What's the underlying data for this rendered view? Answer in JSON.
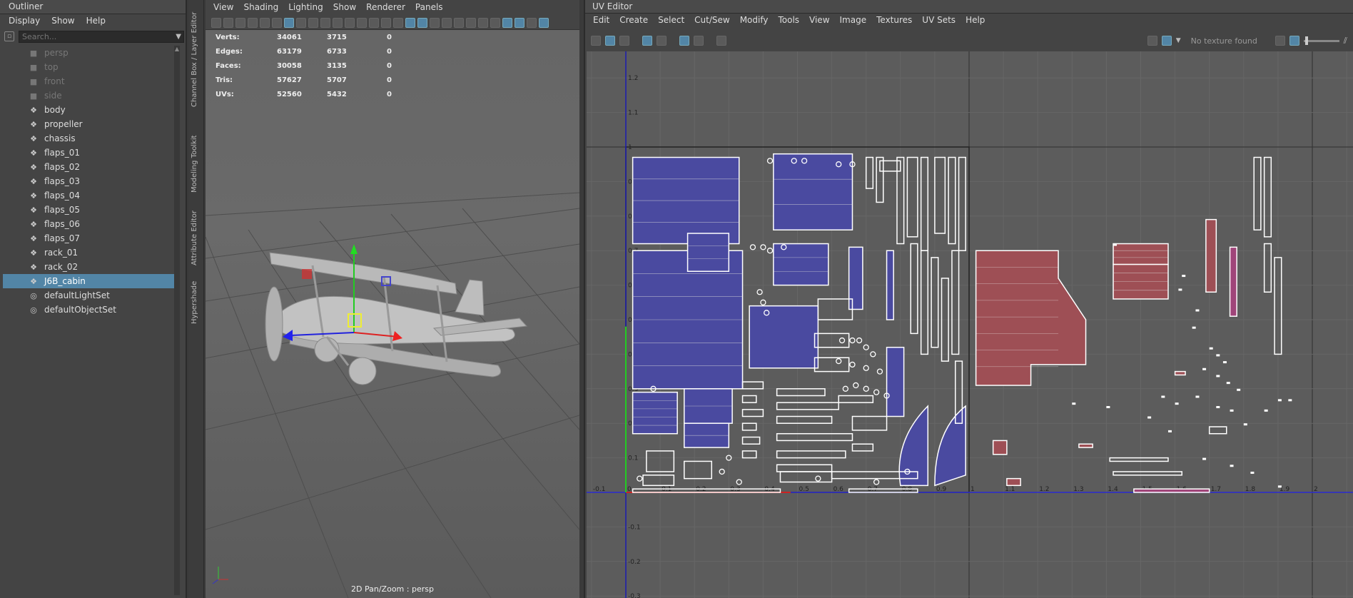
{
  "outliner": {
    "title": "Outliner",
    "menu": [
      "Display",
      "Show",
      "Help"
    ],
    "search_placeholder": "Search...",
    "items": [
      {
        "label": "persp",
        "kind": "camera"
      },
      {
        "label": "top",
        "kind": "camera"
      },
      {
        "label": "front",
        "kind": "camera"
      },
      {
        "label": "side",
        "kind": "camera"
      },
      {
        "label": "body",
        "kind": "mesh"
      },
      {
        "label": "propeller",
        "kind": "mesh"
      },
      {
        "label": "chassis",
        "kind": "mesh"
      },
      {
        "label": "flaps_01",
        "kind": "mesh"
      },
      {
        "label": "flaps_02",
        "kind": "mesh"
      },
      {
        "label": "flaps_03",
        "kind": "mesh"
      },
      {
        "label": "flaps_04",
        "kind": "mesh"
      },
      {
        "label": "flaps_05",
        "kind": "mesh"
      },
      {
        "label": "flaps_06",
        "kind": "mesh"
      },
      {
        "label": "flaps_07",
        "kind": "mesh"
      },
      {
        "label": "rack_01",
        "kind": "mesh"
      },
      {
        "label": "rack_02",
        "kind": "mesh"
      },
      {
        "label": "J6B_cabin",
        "kind": "mesh",
        "selected": true
      },
      {
        "label": "defaultLightSet",
        "kind": "set"
      },
      {
        "label": "defaultObjectSet",
        "kind": "set"
      }
    ]
  },
  "side_tabs": [
    "Channel Box / Layer Editor",
    "Modeling Toolkit",
    "Attribute Editor",
    "Hypershade"
  ],
  "viewport": {
    "menu": [
      "View",
      "Shading",
      "Lighting",
      "Show",
      "Renderer",
      "Panels"
    ],
    "hud": [
      {
        "label": "Verts:",
        "a": "34061",
        "b": "3715",
        "c": "0"
      },
      {
        "label": "Edges:",
        "a": "63179",
        "b": "6733",
        "c": "0"
      },
      {
        "label": "Faces:",
        "a": "30058",
        "b": "3135",
        "c": "0"
      },
      {
        "label": "Tris:",
        "a": "57627",
        "b": "5707",
        "c": "0"
      },
      {
        "label": "UVs:",
        "a": "52560",
        "b": "5432",
        "c": "0"
      }
    ],
    "camera_label": "2D Pan/Zoom : persp"
  },
  "uv_editor": {
    "title": "UV Editor",
    "menu": [
      "Edit",
      "Create",
      "Select",
      "Cut/Sew",
      "Modify",
      "Tools",
      "View",
      "Image",
      "Textures",
      "UV Sets",
      "Help"
    ],
    "texture_status": "No texture found",
    "u_ticks": [
      "-0.1",
      "0",
      "0.1",
      "0.2",
      "0.3",
      "0.4",
      "0.5",
      "0.6",
      "0.7",
      "0.8",
      "0.9",
      "1",
      "1.1",
      "1.2",
      "1.3",
      "1.4",
      "1.5",
      "1.6",
      "1.7",
      "1.8",
      "1.9",
      "2"
    ],
    "v_ticks": [
      "1.2",
      "1.1",
      "1",
      "0.9",
      "0.8",
      "0.7",
      "0.6",
      "0.5",
      "0.4",
      "0.3",
      "0.2",
      "0.1",
      "-0.1",
      "-0.2",
      "-0.3"
    ],
    "colors": {
      "selected_shell": "#4a4aa0",
      "other_shell": "#9e4f55",
      "pink_shell": "#a0457a",
      "u_axis": "#2a2ad0",
      "v_axis": "#1b1bb0"
    }
  }
}
